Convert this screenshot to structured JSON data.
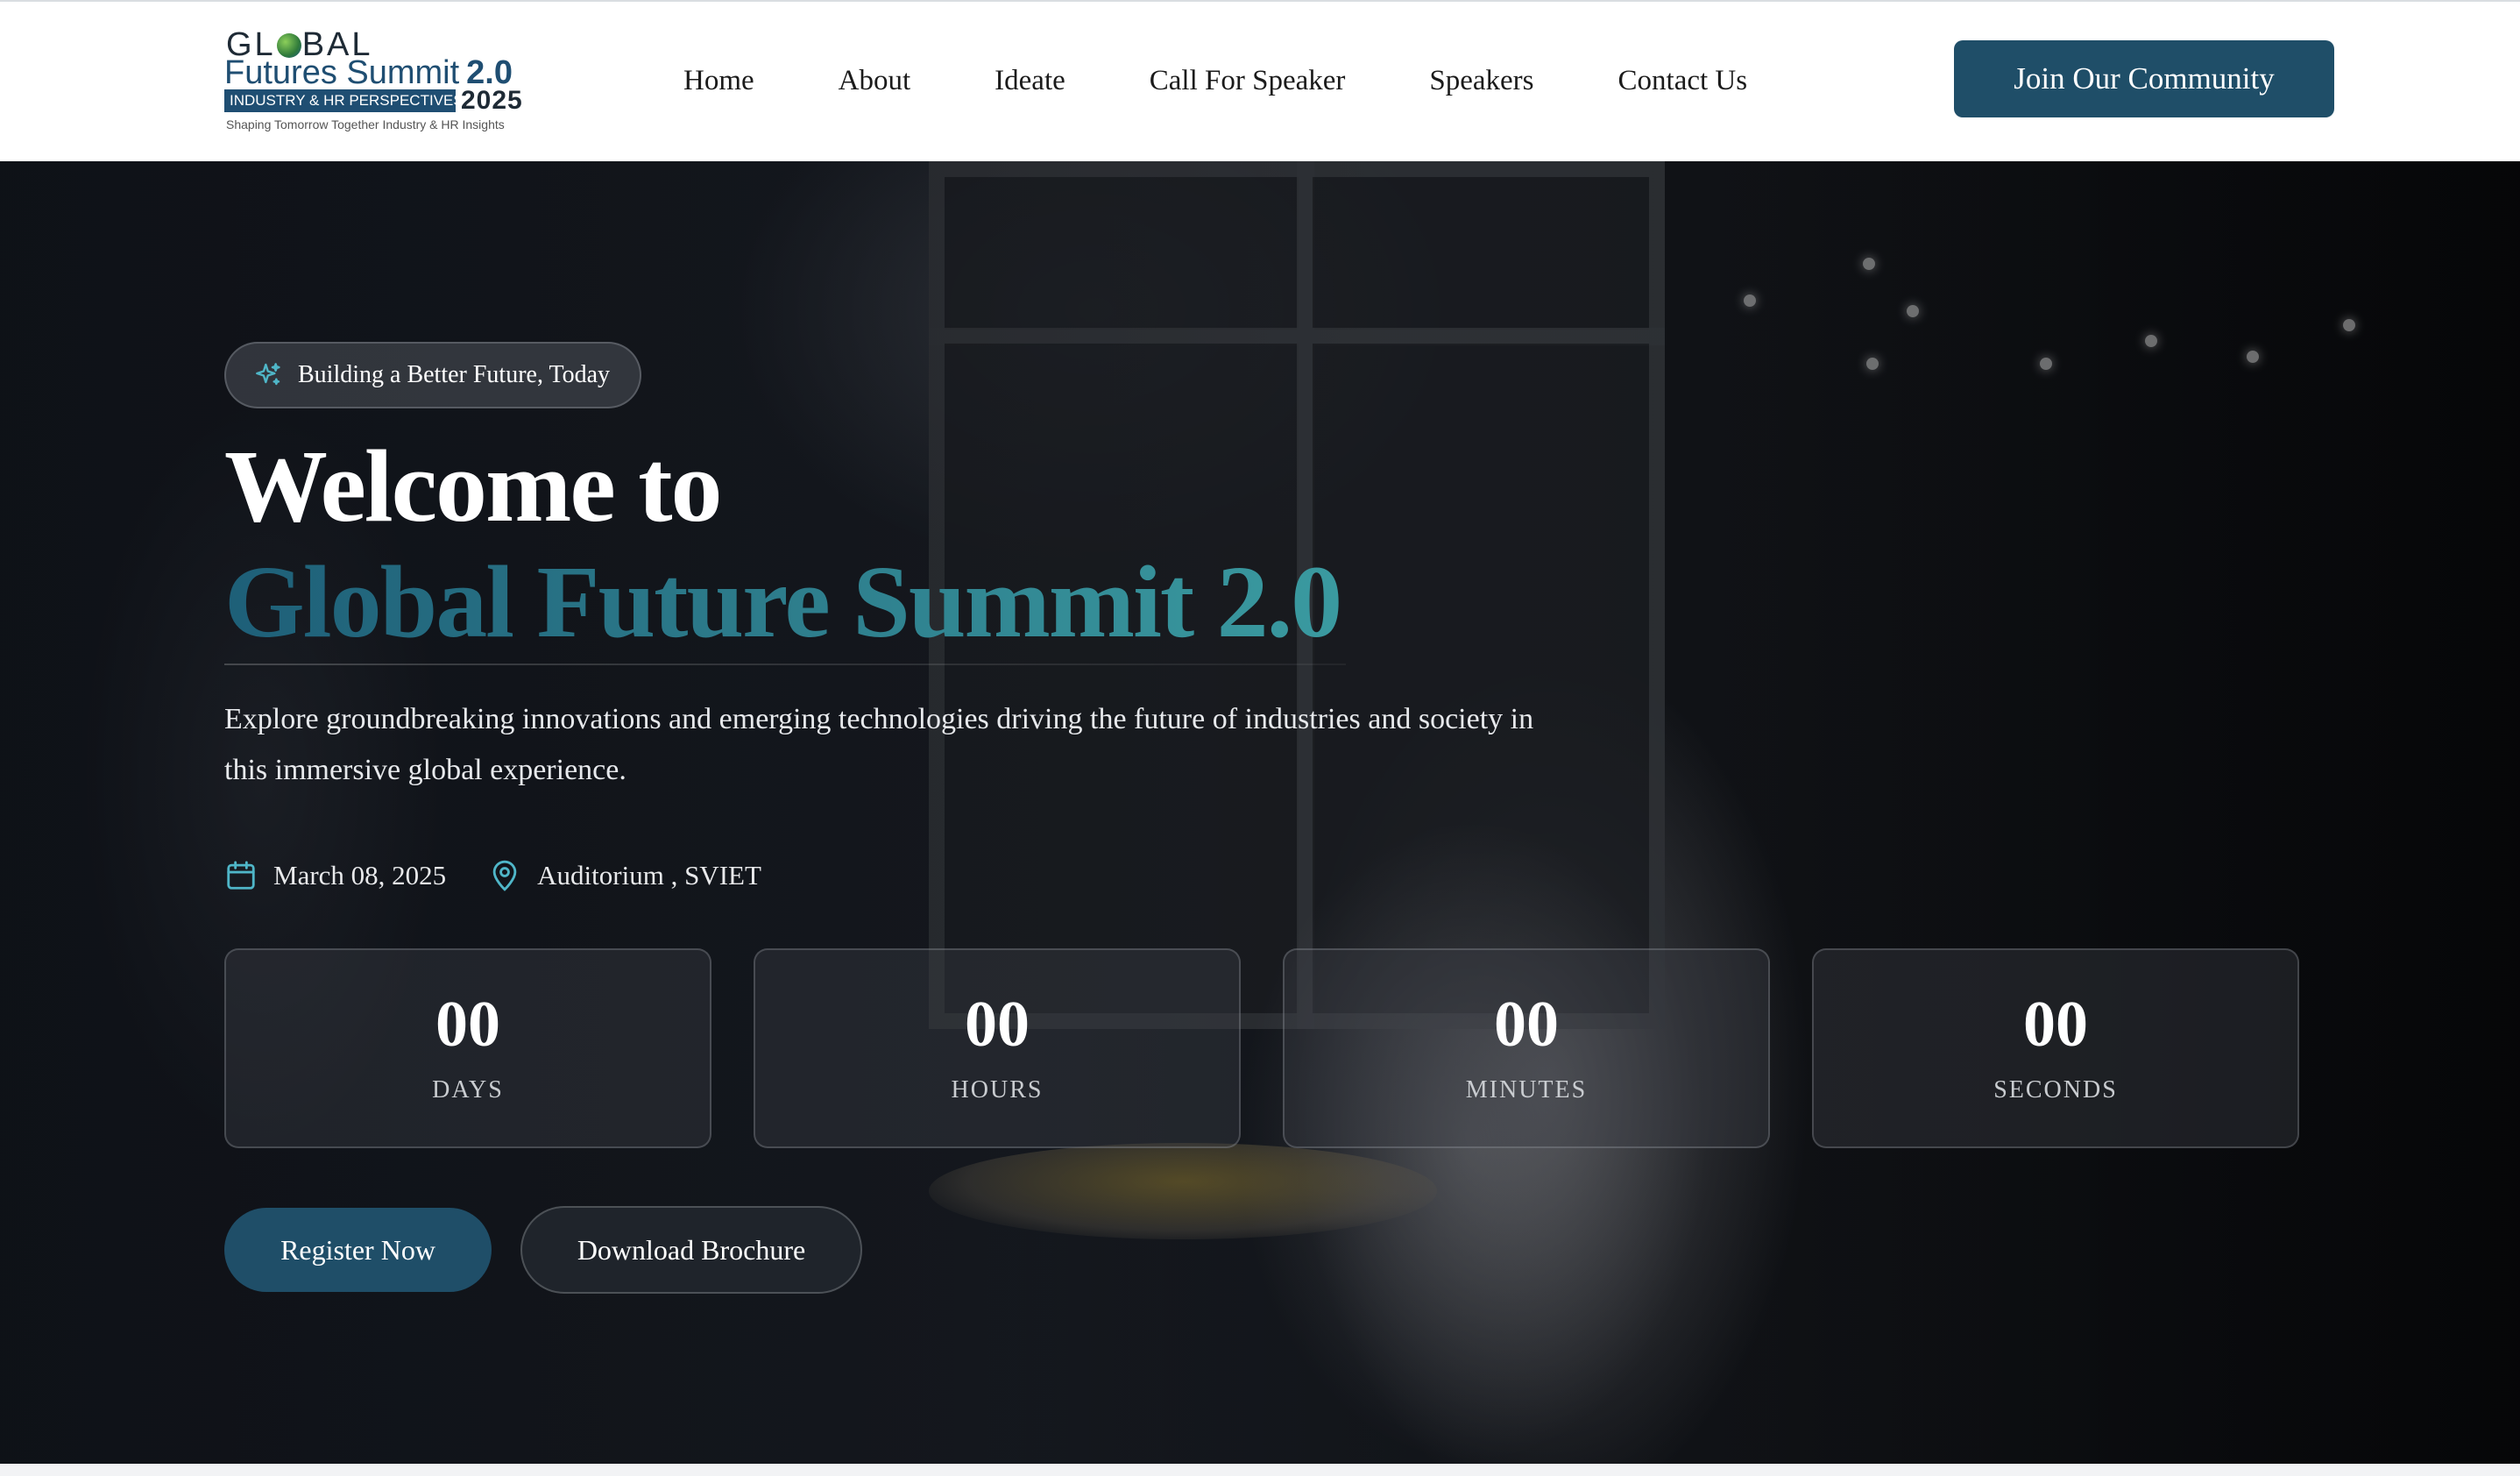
{
  "header": {
    "logo": {
      "line1": "GL",
      "line1b": "BAL",
      "line2a": "Futures Summit",
      "line2b": "2.0",
      "band": "INDUSTRY & HR PERSPECTIVES",
      "year": "2025",
      "tagline": "Shaping Tomorrow Together Industry & HR Insights"
    },
    "nav": [
      "Home",
      "About",
      "Ideate",
      "Call For Speaker",
      "Speakers",
      "Contact Us"
    ],
    "cta": "Join Our Community"
  },
  "hero": {
    "badge": "Building a Better Future, Today",
    "title_line1": "Welcome to",
    "title_line2": "Global Future Summit 2.0",
    "description": "Explore groundbreaking innovations and emerging technologies driving the future of industries and society in this immersive global experience.",
    "date": "March 08, 2025",
    "location": "Auditorium , SVIET",
    "countdown": [
      {
        "value": "00",
        "label": "DAYS"
      },
      {
        "value": "00",
        "label": "HOURS"
      },
      {
        "value": "00",
        "label": "MINUTES"
      },
      {
        "value": "00",
        "label": "SECONDS"
      }
    ],
    "register_label": "Register Now",
    "brochure_label": "Download Brochure"
  },
  "icons": {
    "badge": "sparkle-icon",
    "date": "calendar-icon",
    "location": "map-pin-icon"
  },
  "colors": {
    "accent": "#1f4e68",
    "title_gradient_start": "#1e5f78",
    "title_gradient_end": "#3a9aa0",
    "icon_accent": "#4fb6c8"
  }
}
